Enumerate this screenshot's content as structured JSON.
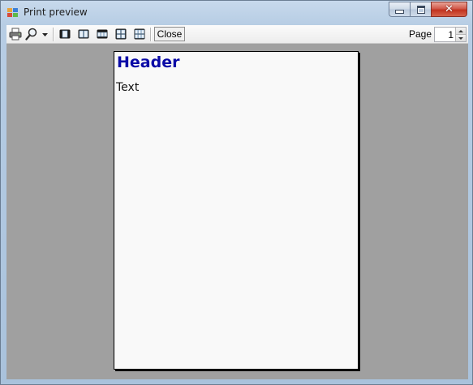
{
  "window": {
    "title": "Print preview",
    "caption_buttons": {
      "minimize_icon": "minimize-icon",
      "maximize_icon": "maximize-icon",
      "close_icon": "close-icon",
      "close_glyph": "✕"
    }
  },
  "toolbar": {
    "print_icon": "printer-icon",
    "zoom_icon": "magnifier-icon",
    "zoom_dropdown_icon": "chevron-down-icon",
    "layouts": [
      {
        "name": "one-page-icon"
      },
      {
        "name": "two-pages-icon"
      },
      {
        "name": "three-pages-icon"
      },
      {
        "name": "four-pages-icon"
      },
      {
        "name": "six-pages-icon"
      }
    ],
    "close_label": "Close",
    "page_label": "Page",
    "page_value": "1"
  },
  "document": {
    "header": "Header",
    "text": "Text",
    "header_color": "#0a0aa6"
  },
  "colors": {
    "preview_background": "#a0a0a0",
    "page_background": "#f9f9f9",
    "close_button_red": "#c2321f"
  }
}
